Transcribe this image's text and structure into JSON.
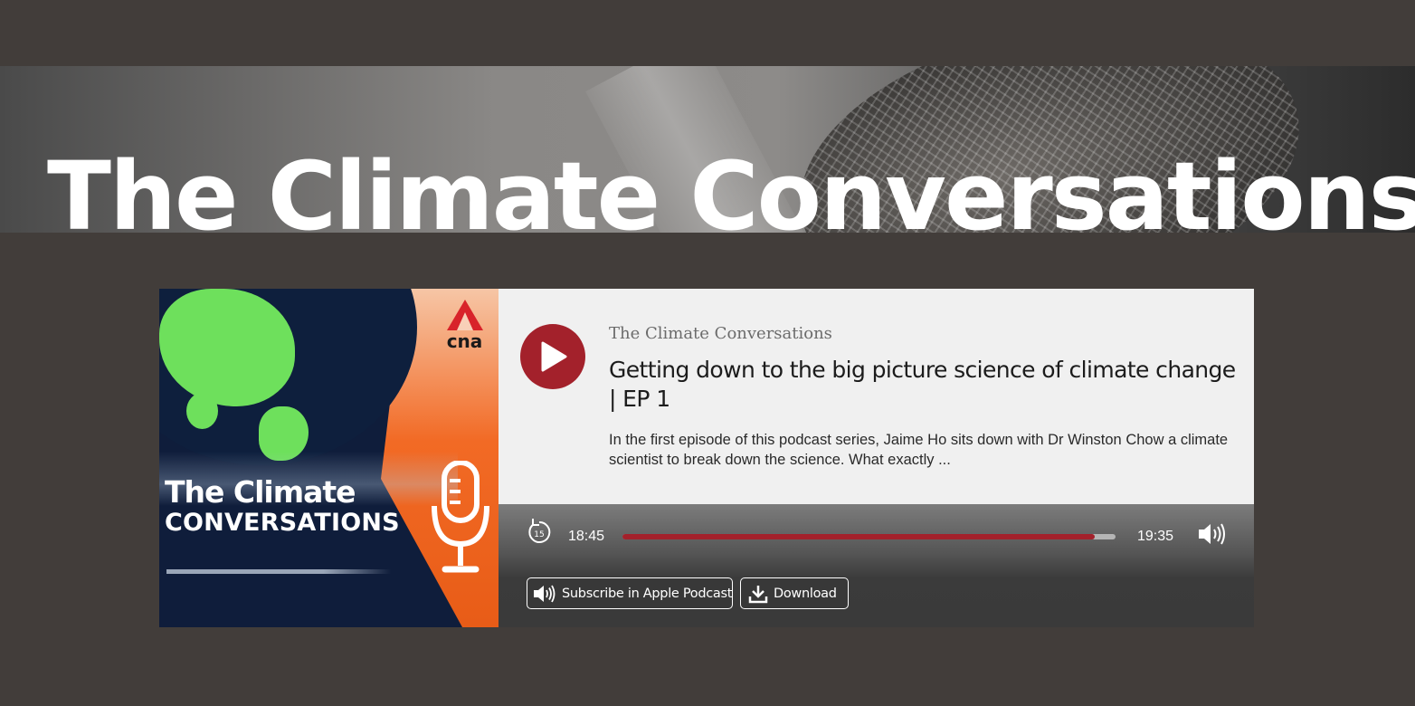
{
  "banner": {
    "title": "The Climate Conversations"
  },
  "cover": {
    "logo_text": "cna",
    "title_line1": "The Climate",
    "title_line2": "CONVERSATIONS"
  },
  "episode": {
    "show_name": "The Climate Conversations",
    "title": "Getting down to the big picture science of climate change | EP 1",
    "description": "In the first episode of this podcast series, Jaime Ho sits down with Dr Winston Chow a climate scientist to break down the science. What exactly ..."
  },
  "player": {
    "current_time": "18:45",
    "total_time": "19:35",
    "progress_fraction": 0.958,
    "skip_back_seconds": "15",
    "accent_color": "#a3212b"
  },
  "buttons": {
    "subscribe_label": "Subscribe in Apple Podcast",
    "download_label": "Download"
  },
  "icons": {
    "play": "play-icon",
    "skip_back": "rewind-15-icon",
    "volume": "volume-icon",
    "subscribe": "speaker-icon",
    "download": "download-icon"
  }
}
